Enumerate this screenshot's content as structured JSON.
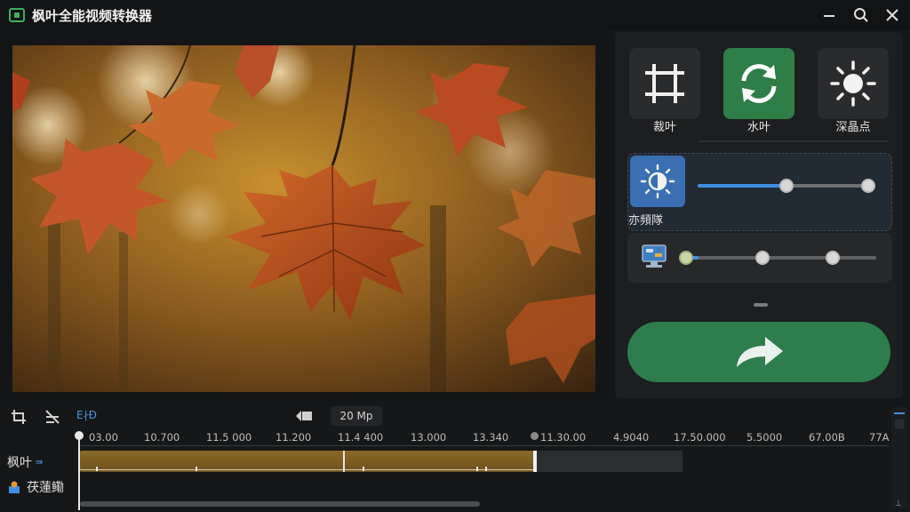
{
  "app": {
    "title": "枫叶全能视频转换器"
  },
  "window_controls": [
    "minimize-icon",
    "search-icon",
    "close-icon"
  ],
  "player": {
    "left_icons": [
      "layers-icon",
      "crop-frame-icon"
    ],
    "center_icons": [
      "skip-back-icon",
      "play-icon",
      "skip-forward-icon"
    ],
    "right_icons": [
      "swap-icon"
    ]
  },
  "tools": [
    {
      "label": "裁叶",
      "icon": "crop-icon",
      "active": false
    },
    {
      "label": "水叶",
      "icon": "rotate-icon",
      "active": true
    },
    {
      "label": "深晶点",
      "icon": "sun-icon",
      "active": false
    }
  ],
  "brightness": {
    "label": "亦頻隊",
    "level": 0.5,
    "max": 1.0
  },
  "color": {
    "knobs": [
      0.0,
      0.4,
      0.77
    ]
  },
  "export": {
    "icon": "share-arrow-icon"
  },
  "timeline": {
    "toolbar_icons": [
      "trim-icon",
      "cut-icon"
    ],
    "toolbar_text": "E∤Ð",
    "zoom_icon": "marker-flag-icon",
    "zoom_value": "20 Mp",
    "ticks": [
      "03.00",
      "10.700",
      "11.5 000",
      "11.200",
      "11.4 400",
      "13.000",
      "13.340",
      "11.30.00",
      "4.9040",
      "17.50.000",
      "5.5000",
      "67.00B",
      "77A"
    ],
    "tracks": [
      {
        "label": "枫叶",
        "suffix": "⇛"
      },
      {
        "label": "茯蓮鰳",
        "icon": "track-person-icon"
      }
    ]
  },
  "colors": {
    "accent_green": "#2e7d4c",
    "accent_blue": "#3a6fb3",
    "clip": "#7a5d24"
  }
}
